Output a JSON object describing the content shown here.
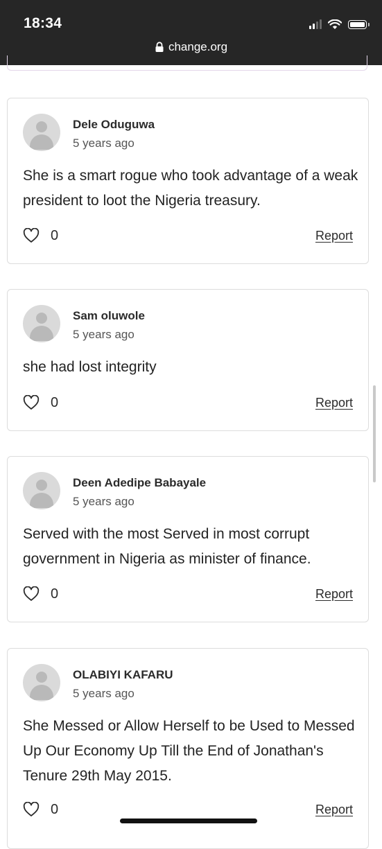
{
  "status_bar": {
    "time": "18:34",
    "url": "change.org"
  },
  "comments": [
    {
      "author": "Dele Oduguwa",
      "time_ago": "5 years ago",
      "text": "She is a smart rogue who took advantage of a weak president to loot the Nigeria treasury.",
      "likes": "0",
      "report_label": "Report"
    },
    {
      "author": "Sam oluwole",
      "time_ago": "5 years ago",
      "text": "she had lost integrity",
      "likes": "0",
      "report_label": "Report"
    },
    {
      "author": "Deen Adedipe Babayale",
      "time_ago": "5 years ago",
      "text": "Served with the most Served in most corrupt government in Nigeria as minister of finance.",
      "likes": "0",
      "report_label": "Report"
    },
    {
      "author": "OLABIYI KAFARU",
      "time_ago": "5 years ago",
      "text": "She Messed or Allow Herself to be Used to Messed Up Our Economy Up Till the End of Jonathan's Tenure 29th May 2015.",
      "likes": "0",
      "report_label": "Report"
    }
  ],
  "colors": {
    "top_bar": "#262626",
    "card_border": "#dcdcdc",
    "avatar_bg": "#dadada"
  }
}
